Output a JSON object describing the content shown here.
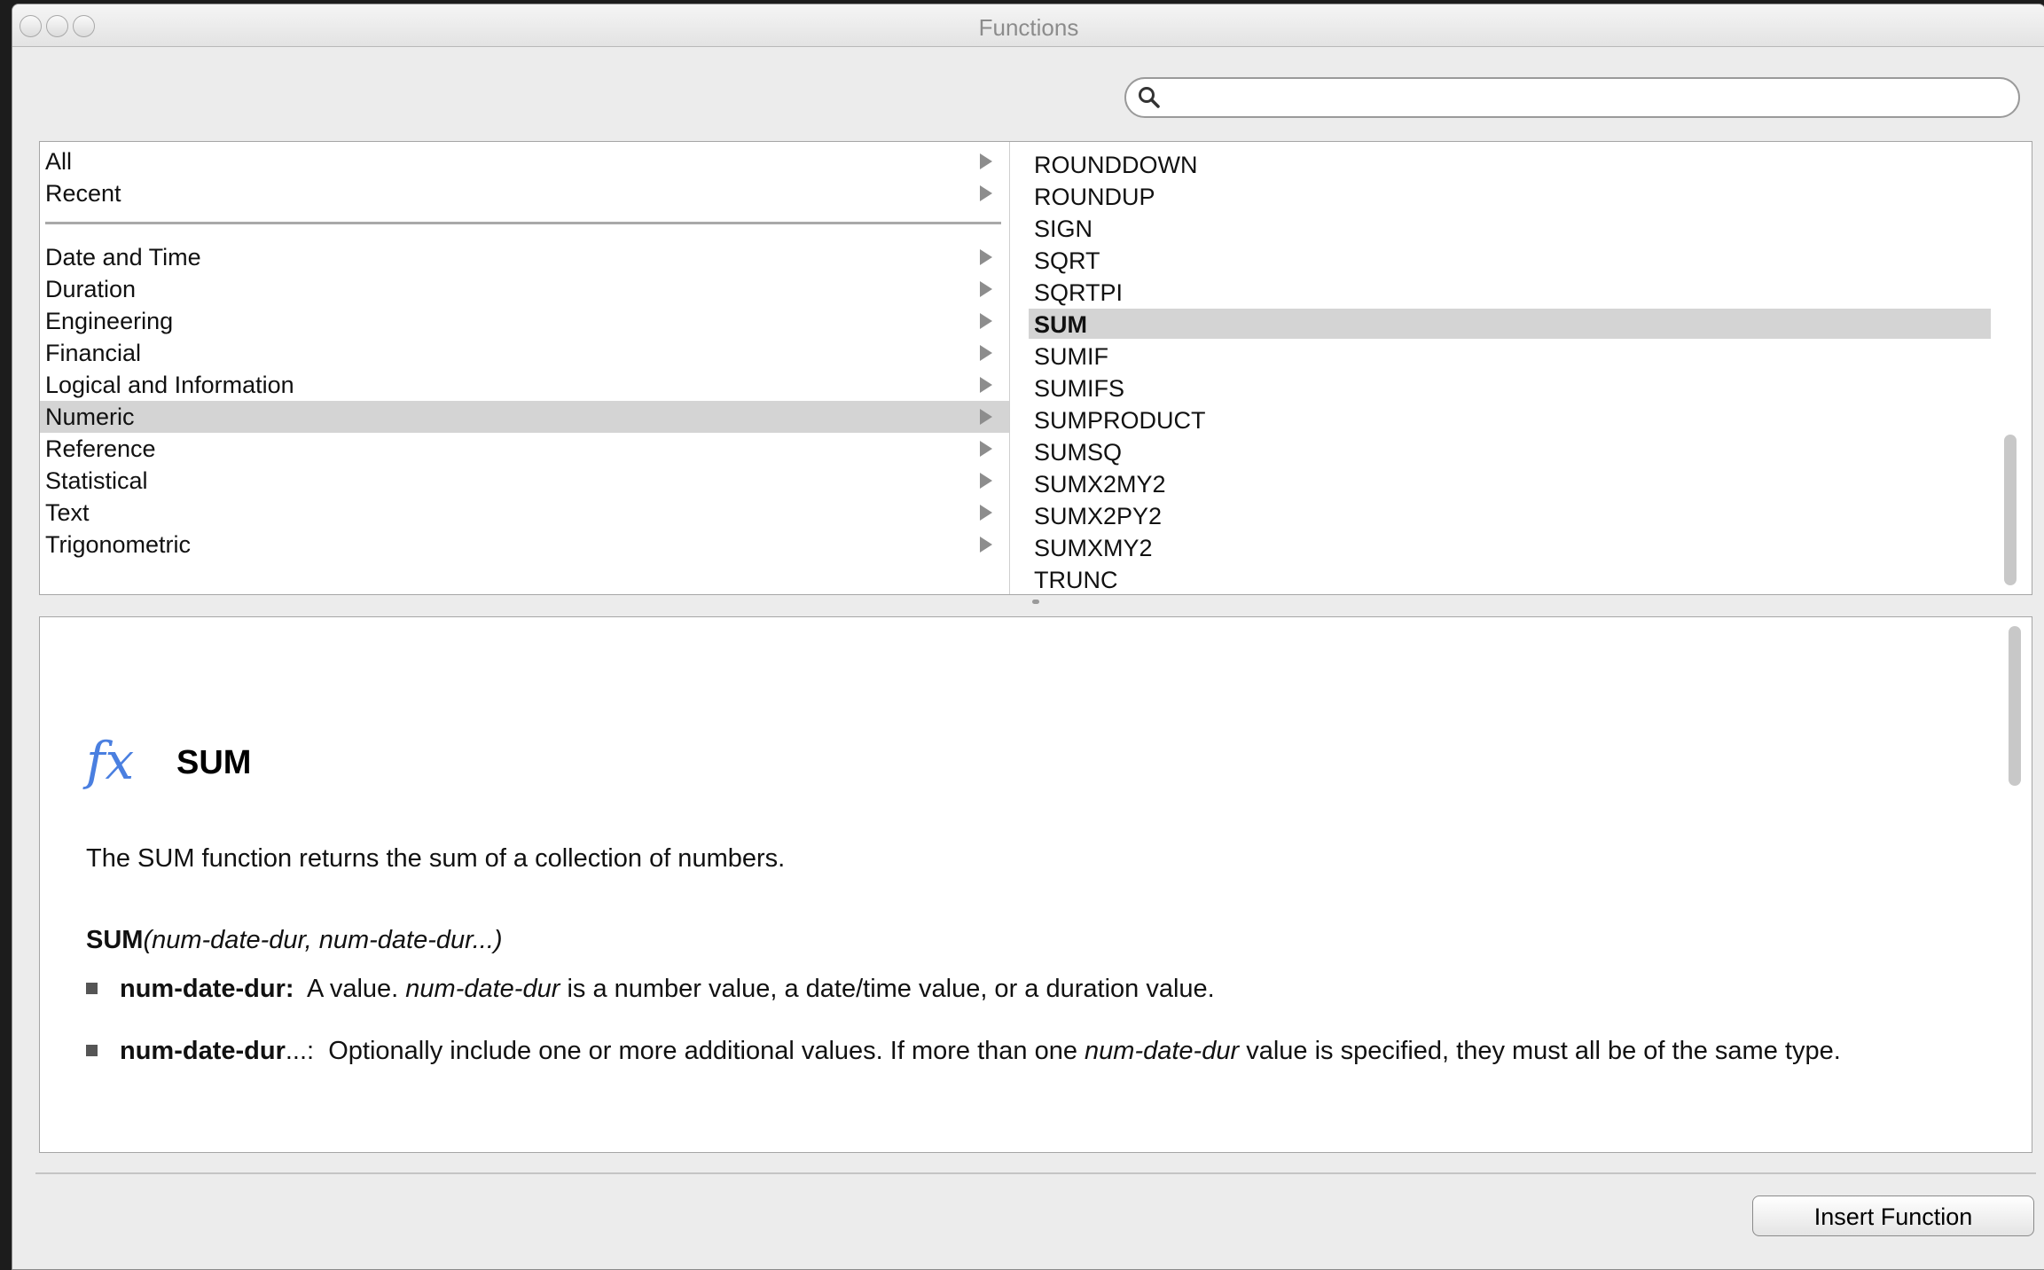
{
  "window": {
    "title": "Functions"
  },
  "search": {
    "value": "",
    "placeholder": ""
  },
  "categories": [
    {
      "label": "All"
    },
    {
      "label": "Recent"
    },
    {
      "label": "Date and Time"
    },
    {
      "label": "Duration"
    },
    {
      "label": "Engineering"
    },
    {
      "label": "Financial"
    },
    {
      "label": "Logical and Information"
    },
    {
      "label": "Numeric"
    },
    {
      "label": "Reference"
    },
    {
      "label": "Statistical"
    },
    {
      "label": "Text"
    },
    {
      "label": "Trigonometric"
    }
  ],
  "selected_category": "Numeric",
  "functions": [
    {
      "label": "ROUNDDOWN"
    },
    {
      "label": "ROUNDUP"
    },
    {
      "label": "SIGN"
    },
    {
      "label": "SQRT"
    },
    {
      "label": "SQRTPI"
    },
    {
      "label": "SUM"
    },
    {
      "label": "SUMIF"
    },
    {
      "label": "SUMIFS"
    },
    {
      "label": "SUMPRODUCT"
    },
    {
      "label": "SUMSQ"
    },
    {
      "label": "SUMX2MY2"
    },
    {
      "label": "SUMX2PY2"
    },
    {
      "label": "SUMXMY2"
    },
    {
      "label": "TRUNC"
    }
  ],
  "selected_function": "SUM",
  "detail": {
    "fx_symbol": "fx",
    "name": "SUM",
    "description": "The SUM function returns the sum of a collection of numbers.",
    "syntax_name": "SUM",
    "syntax_args": "(num-date-dur, num-date-dur...)",
    "args": [
      {
        "name": "num-date-dur:",
        "text_a": "A value.",
        "italic": "num-date-dur",
        "text_b": "is a number value, a date/time value, or a duration value."
      },
      {
        "name": "num-date-dur",
        "name_suffix": "...:",
        "text_a": "Optionally include one or more additional values. If more than one",
        "italic": "num-date-dur",
        "text_b": "value is specified, they must all be of the same type."
      }
    ]
  },
  "buttons": {
    "insert": "Insert Function"
  },
  "colors": {
    "fx": "#4a7fe0",
    "selection": "#d4d4d4"
  }
}
